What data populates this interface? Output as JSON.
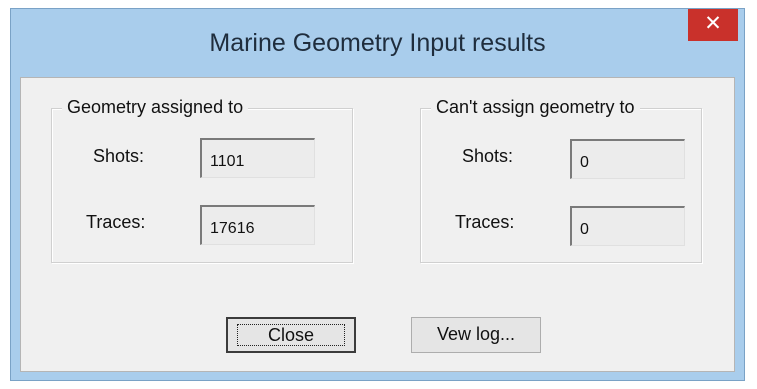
{
  "window": {
    "title": "Marine Geometry Input results",
    "close_glyph": "✕"
  },
  "assigned": {
    "legend": "Geometry assigned to",
    "shots_label": "Shots:",
    "shots_value": "1101",
    "traces_label": "Traces:",
    "traces_value": "17616"
  },
  "unassigned": {
    "legend": "Can't assign geometry to",
    "shots_label": "Shots:",
    "shots_value": "0",
    "traces_label": "Traces:",
    "traces_value": "0"
  },
  "buttons": {
    "close": "Close",
    "view_log": "Vew log..."
  },
  "colors": {
    "titlebar": "#a9cdec",
    "close": "#c9312b",
    "client": "#f0f0f0"
  }
}
